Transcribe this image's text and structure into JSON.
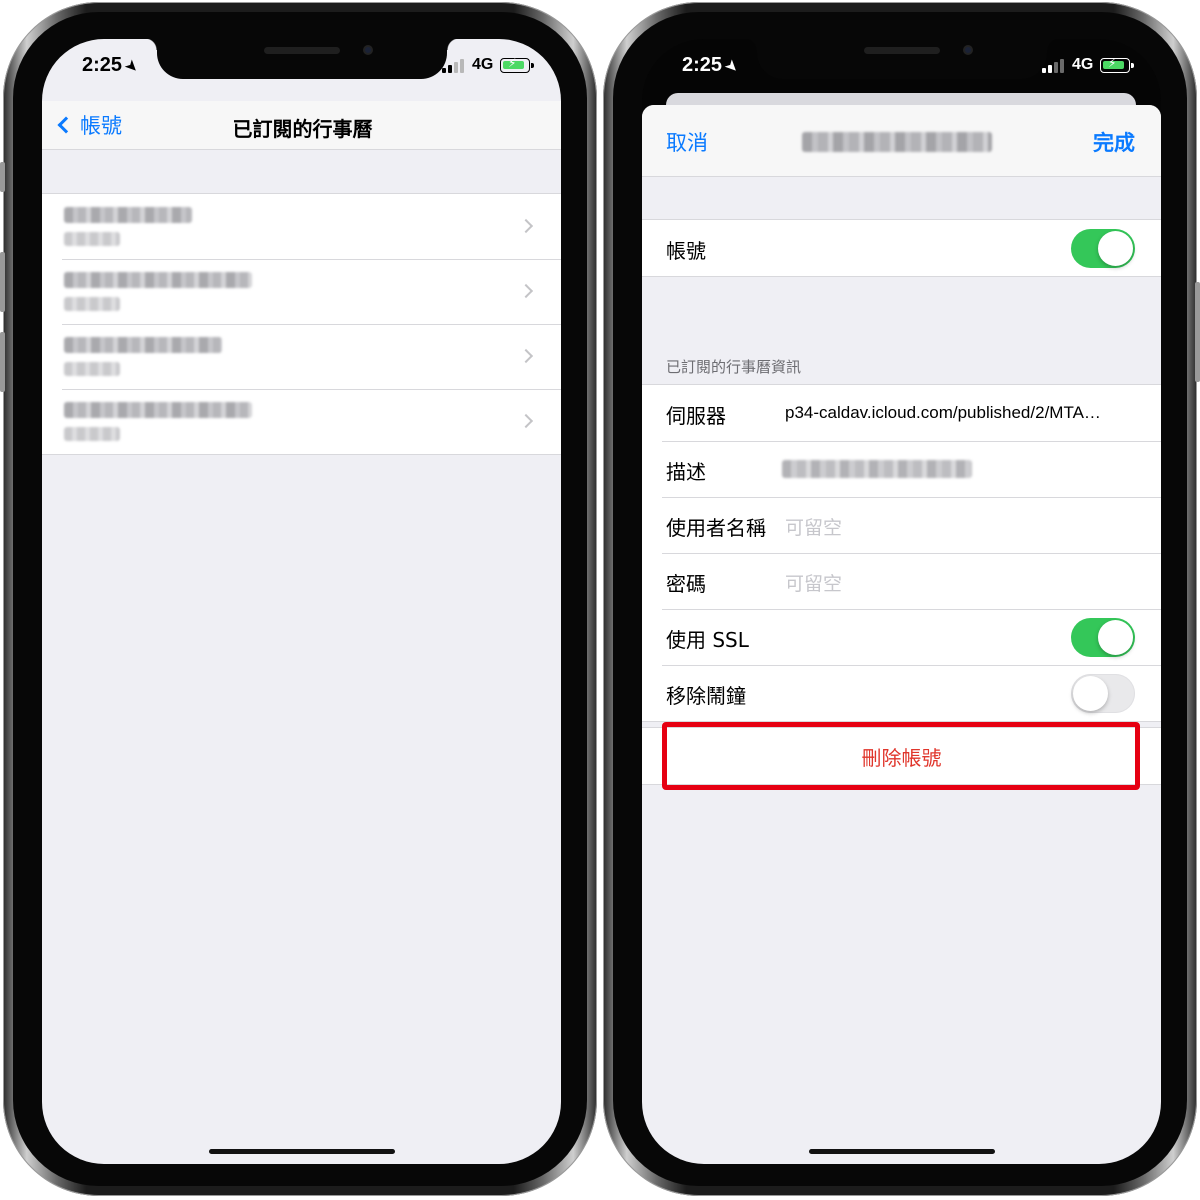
{
  "status_bar": {
    "time": "2:25",
    "network": "4G"
  },
  "left_screen": {
    "nav": {
      "back_label": "帳號",
      "title": "已訂閱的行事曆"
    },
    "calendars": [
      {
        "title": "",
        "subtitle": ""
      },
      {
        "title": "",
        "subtitle": ""
      },
      {
        "title": "",
        "subtitle": ""
      },
      {
        "title": "",
        "subtitle": ""
      }
    ]
  },
  "right_screen": {
    "nav": {
      "cancel_label": "取消",
      "done_label": "完成"
    },
    "account": {
      "label": "帳號",
      "enabled": true
    },
    "info_section": {
      "header": "已訂閱的行事曆資訊",
      "server_label": "伺服器",
      "server_value": "p34-caldav.icloud.com/published/2/MTA…",
      "description_label": "描述",
      "username_label": "使用者名稱",
      "username_placeholder": "可留空",
      "password_label": "密碼",
      "password_placeholder": "可留空",
      "ssl_label": "使用 SSL",
      "ssl_enabled": true,
      "remove_alarms_label": "移除鬧鐘",
      "remove_alarms_enabled": false
    },
    "delete_label": "刪除帳號"
  },
  "colors": {
    "ios_blue": "#0a7aff",
    "toggle_green": "#34c759",
    "delete_red": "#e0352b",
    "highlight_red": "#e60012",
    "battery_green": "#4cd964"
  }
}
